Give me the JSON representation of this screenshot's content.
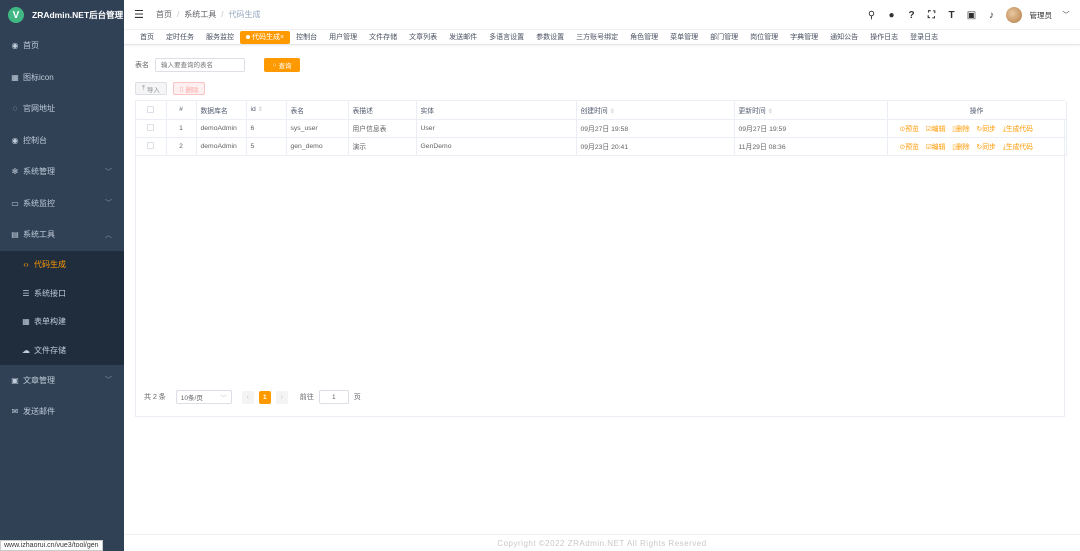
{
  "app": {
    "logo_letter": "V",
    "title": "ZRAdmin.NET后台管理"
  },
  "sidebar": {
    "items": [
      {
        "icon": "dashboard-icon",
        "glyph": "◉",
        "label": "首页"
      },
      {
        "icon": "grid-icon",
        "glyph": "▦",
        "label": "图标icon"
      },
      {
        "icon": "globe-icon",
        "glyph": "◌",
        "label": "官网地址"
      },
      {
        "icon": "dashboard-icon",
        "glyph": "◉",
        "label": "控制台"
      },
      {
        "icon": "gear-icon",
        "glyph": "✻",
        "label": "系统管理"
      },
      {
        "icon": "monitor-icon",
        "glyph": "▭",
        "label": "系统监控"
      },
      {
        "icon": "toolbox-icon",
        "glyph": "▤",
        "label": "系统工具"
      }
    ],
    "tool_sub": [
      {
        "icon": "code-icon",
        "glyph": "‹›",
        "label": "代码生成"
      },
      {
        "icon": "api-icon",
        "glyph": "☰",
        "label": "系统接口"
      },
      {
        "icon": "form-icon",
        "glyph": "▦",
        "label": "表单构建"
      },
      {
        "icon": "cloud-icon",
        "glyph": "☁",
        "label": "文件存储"
      }
    ],
    "bottom": [
      {
        "icon": "article-icon",
        "glyph": "▣",
        "label": "文章管理"
      },
      {
        "icon": "mail-icon",
        "glyph": "✉",
        "label": "发送邮件"
      }
    ],
    "status_url": "www.izhaorui.cn/vue3/tool/gen"
  },
  "breadcrumb": {
    "home": "首页",
    "parent": "系统工具",
    "current": "代码生成"
  },
  "user": {
    "name": "管理员"
  },
  "tags": [
    "首页",
    "定时任务",
    "服务监控",
    "代码生成",
    "控制台",
    "用户管理",
    "文件存储",
    "文章列表",
    "发送邮件",
    "多语言设置",
    "参数设置",
    "三方账号绑定",
    "角色管理",
    "菜单管理",
    "部门管理",
    "岗位管理",
    "字典管理",
    "通知公告",
    "操作日志",
    "登录日志"
  ],
  "search": {
    "label": "表名",
    "placeholder": "输入要查询的表名",
    "button": "查询"
  },
  "ops": {
    "import": "导入",
    "delete": "删除"
  },
  "table": {
    "headers": {
      "index": "#",
      "db": "数据库名",
      "id": "id",
      "table": "表名",
      "desc": "表描述",
      "entity": "实体",
      "created": "创建时间",
      "updated": "更新时间",
      "ops": "操作"
    },
    "rows": [
      {
        "index": "1",
        "db": "demoAdmin",
        "id": "6",
        "table": "sys_user",
        "desc": "用户信息表",
        "entity": "User",
        "created": "09月27日 19:58",
        "updated": "09月27日 19:59"
      },
      {
        "index": "2",
        "db": "demoAdmin",
        "id": "5",
        "table": "gen_demo",
        "desc": "演示",
        "entity": "GenDemo",
        "created": "09月23日 20:41",
        "updated": "11月29日 08:36"
      }
    ],
    "actions": {
      "preview": "预览",
      "edit": "编辑",
      "delete": "删除",
      "sync": "同步",
      "generate": "生成代码"
    }
  },
  "pager": {
    "total": "共 2 条",
    "page_size": "10条/页",
    "current_page": "1",
    "goto_label": "前往",
    "goto_value": "1",
    "page_suffix": "页"
  },
  "footer": "Copyright ©2022 ZRAdmin.NET All Rights Reserved",
  "colors": {
    "accent": "#ff9900",
    "sidebar": "#304156"
  }
}
